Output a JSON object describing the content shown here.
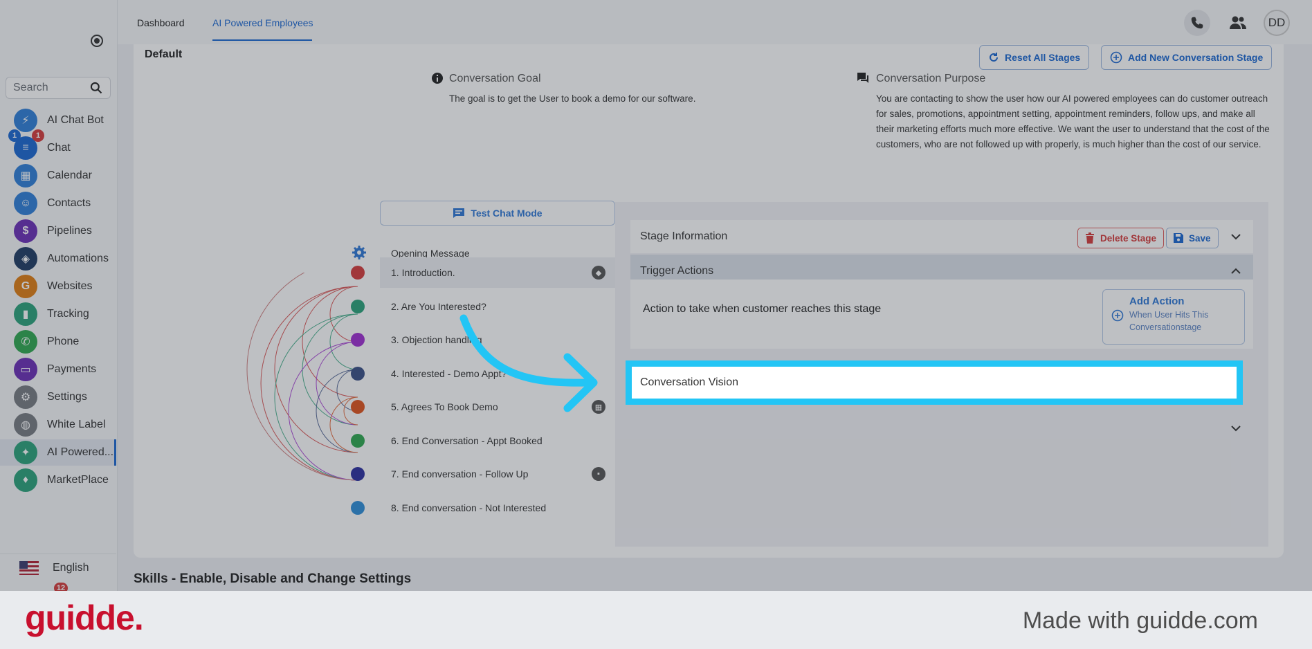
{
  "sidebar": {
    "search_placeholder": "Search",
    "items": [
      {
        "label": "AI Chat Bot",
        "icon": "bolt-icon",
        "color": "#2f7fd9"
      },
      {
        "label": "Chat",
        "icon": "chat-icon",
        "color": "#1b67d1"
      },
      {
        "label": "Calendar",
        "icon": "calendar-icon",
        "color": "#2f7fd9"
      },
      {
        "label": "Contacts",
        "icon": "contacts-icon",
        "color": "#2f7fd9"
      },
      {
        "label": "Pipelines",
        "icon": "dollar-icon",
        "color": "#6a2fb7"
      },
      {
        "label": "Automations",
        "icon": "automation-icon",
        "color": "#1f3b64"
      },
      {
        "label": "Websites",
        "icon": "globe-icon",
        "color": "#e07d12"
      },
      {
        "label": "Tracking",
        "icon": "chart-icon",
        "color": "#2aa37a"
      },
      {
        "label": "Phone",
        "icon": "phone-icon",
        "color": "#2fa84f"
      },
      {
        "label": "Payments",
        "icon": "card-icon",
        "color": "#6a2fb7"
      },
      {
        "label": "Settings",
        "icon": "gear-icon",
        "color": "#777b82"
      },
      {
        "label": "White Label",
        "icon": "palette-icon",
        "color": "#777b82"
      },
      {
        "label": "AI Powered...",
        "icon": "ai-chat-icon",
        "color": "#2aa37a"
      },
      {
        "label": "MarketPlace",
        "icon": "marketplace-icon",
        "color": "#2aa37a"
      }
    ],
    "chat_badge_left": "1",
    "chat_badge_right": "1",
    "bottom_badge": "12",
    "language": "English"
  },
  "header": {
    "tabs": [
      "Dashboard",
      "AI Powered Employees"
    ],
    "avatar": "DD"
  },
  "card": {
    "title": "Default",
    "reset_button": "Reset All Stages",
    "add_stage_button": "Add New Conversation Stage",
    "goal_label": "Conversation Goal",
    "goal_text": "The goal is to get the User to book a demo for our software.",
    "purpose_label": "Conversation Purpose",
    "purpose_text": "You are contacting to show the user how our AI powered employees can do customer outreach for sales, promotions, appointment setting, appointment reminders, follow ups, and make all their marketing efforts much more effective. We want the user to understand that the cost of the customers, who are not followed up with properly, is much higher than the cost of our service."
  },
  "stages": {
    "test_chat": "Test Chat Mode",
    "opening": "Opening Message",
    "items": [
      {
        "label": "1. Introduction.",
        "color": "#d63b3b"
      },
      {
        "label": "2. Are You Interested?",
        "color": "#2aa37a"
      },
      {
        "label": "3. Objection handling",
        "color": "#a02fd1"
      },
      {
        "label": "4. Interested - Demo Appt?",
        "color": "#3a4f86"
      },
      {
        "label": "5. Agrees To Book Demo",
        "color": "#e0531e"
      },
      {
        "label": "6. End Conversation - Appt Booked",
        "color": "#2fa84f"
      },
      {
        "label": "7. End conversation - Follow Up",
        "color": "#2c2ea0"
      },
      {
        "label": "8. End conversation - Not Interested",
        "color": "#2f8fd9"
      }
    ]
  },
  "panel": {
    "stage_info": "Stage Information",
    "delete_stage": "Delete Stage",
    "save": "Save",
    "trigger_actions": "Trigger Actions",
    "trigger_question": "Action to take when customer reaches this stage",
    "add_action_title": "Add Action",
    "add_action_sub": "When User Hits This Conversationstage",
    "conversation_vision": "Conversation Vision"
  },
  "skills_title": "Skills - Enable, Disable and Change Settings",
  "footer": {
    "brand": "guidde.",
    "made_with": "Made with guidde.com",
    "brand_color": "#c8102e",
    "highlight_color": "#23c5f5"
  }
}
